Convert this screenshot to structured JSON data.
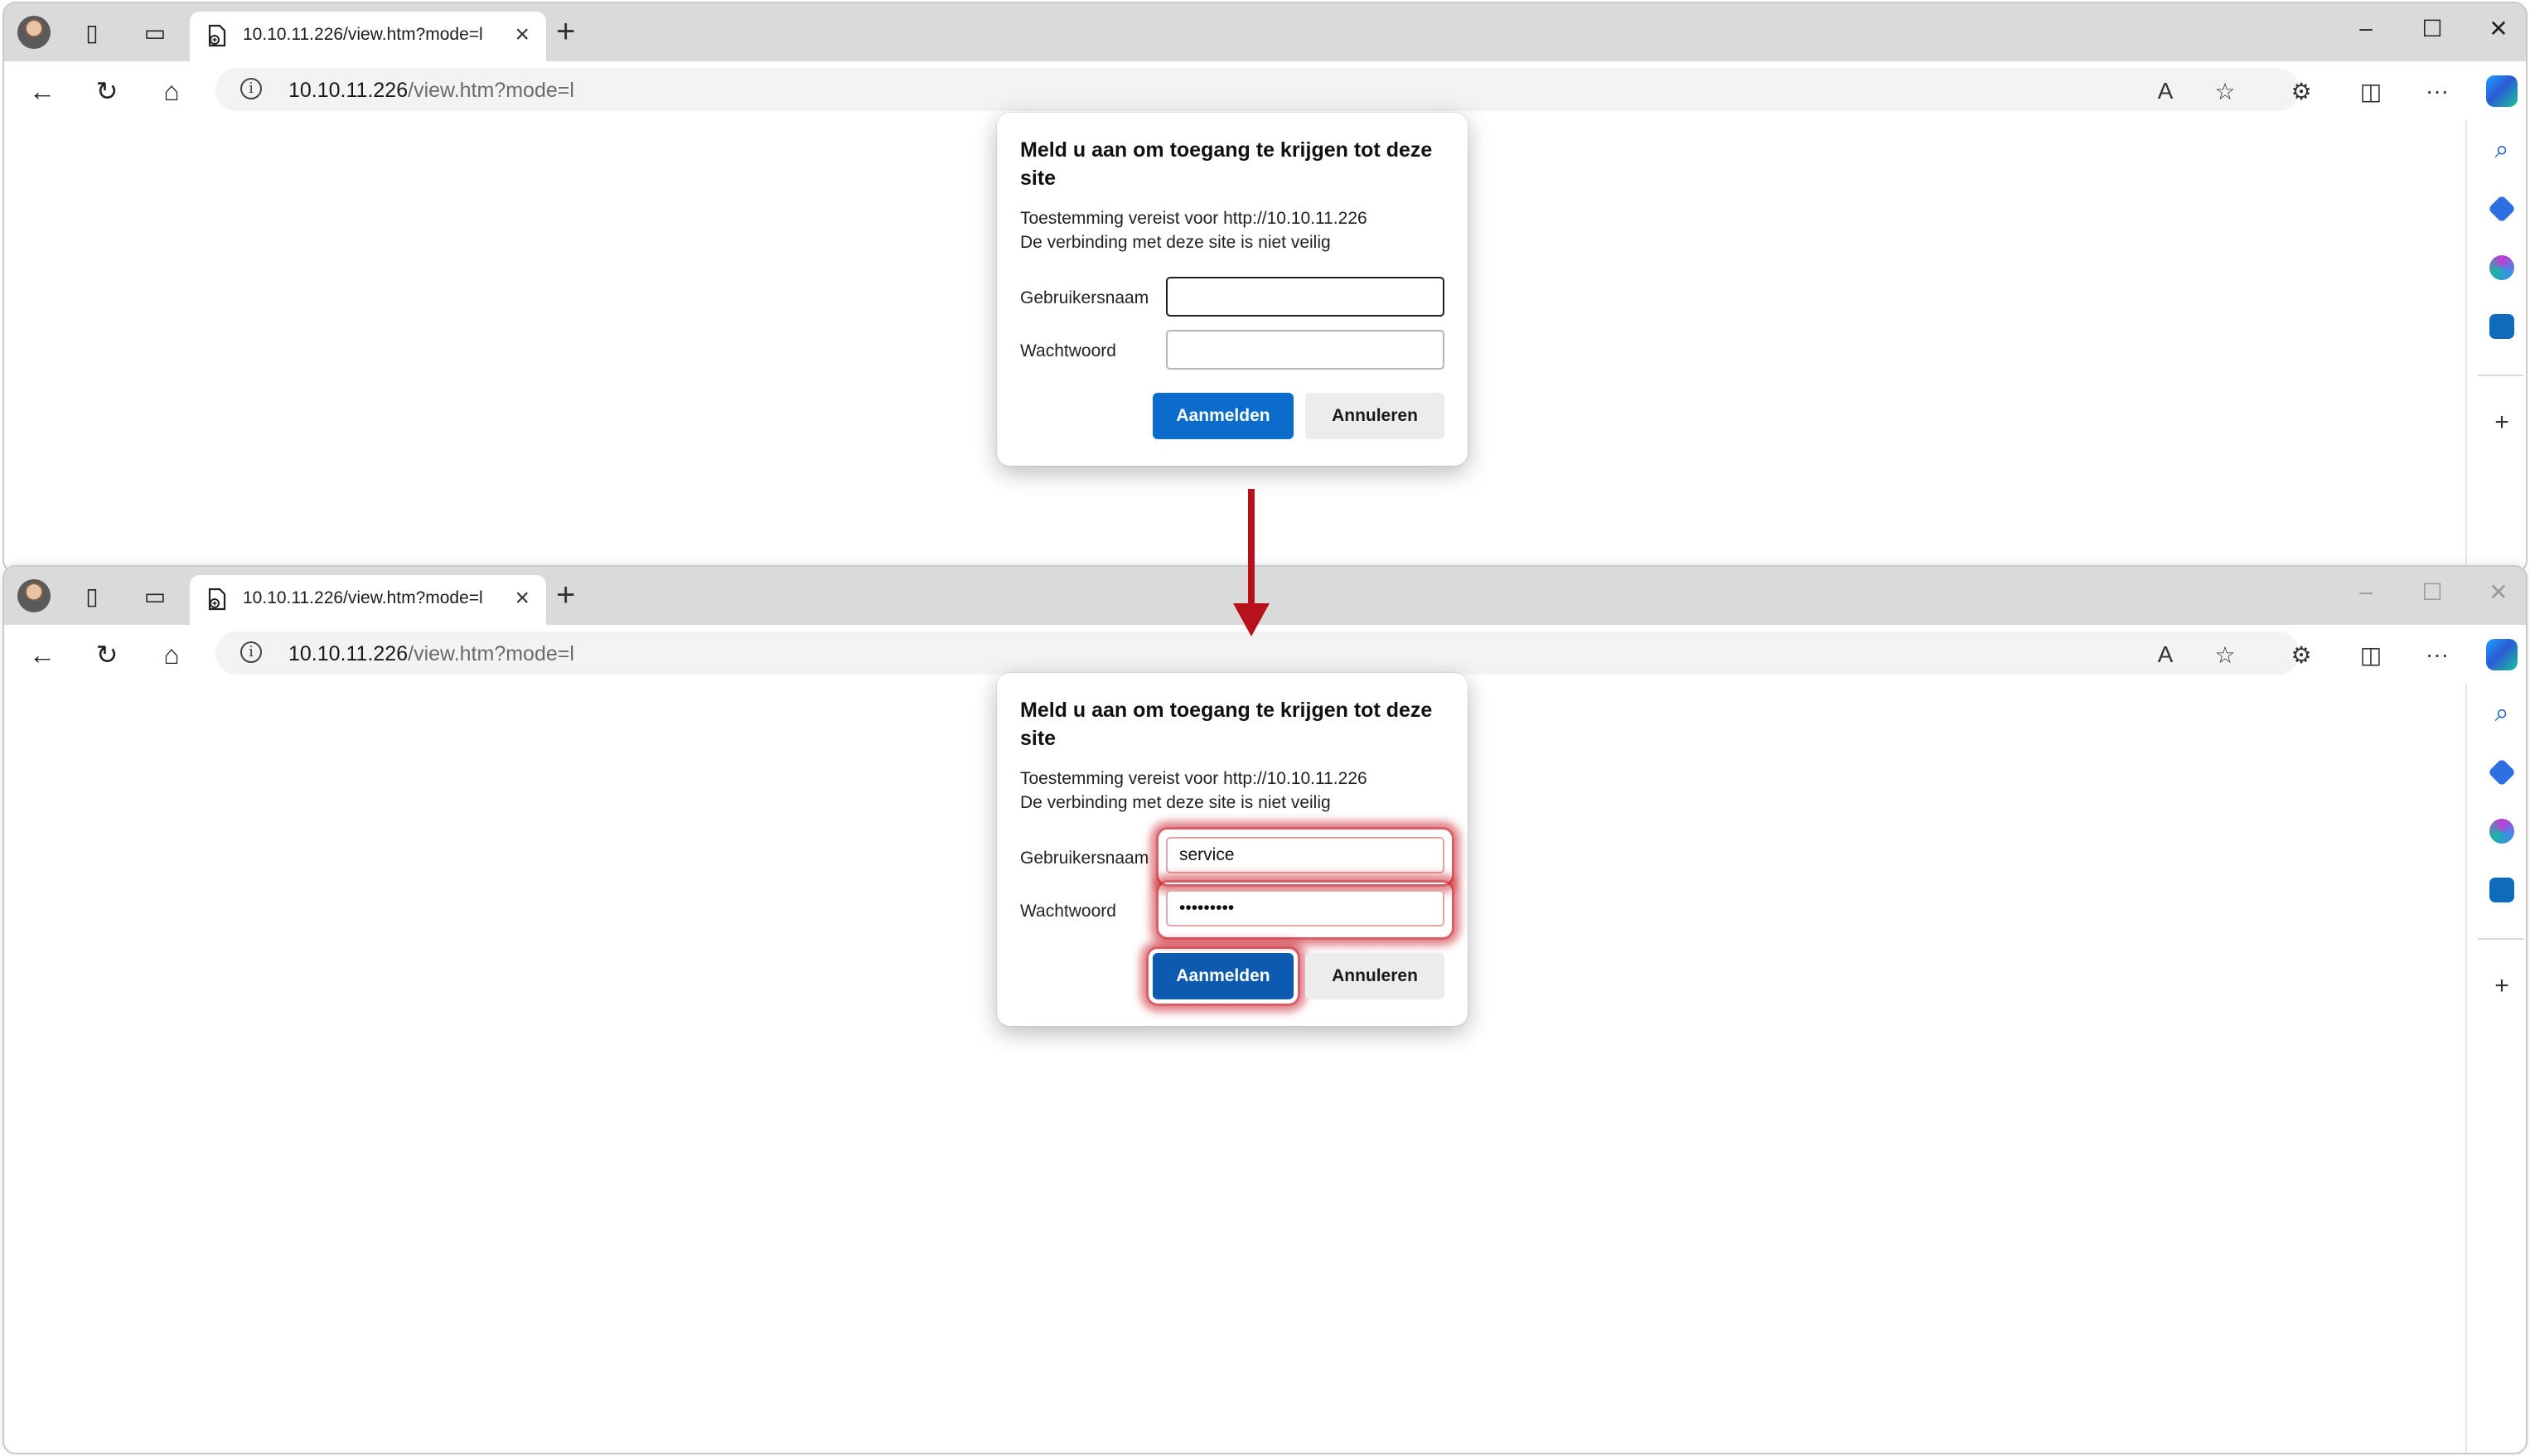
{
  "browser_top": {
    "tab": {
      "title": "10.10.11.226/view.htm?mode=l"
    },
    "address": {
      "host": "10.10.11.226",
      "path": "/view.htm?mode=l"
    },
    "dialog": {
      "title": "Meld u aan om toegang te krijgen tot deze site",
      "permission_line": "Toestemming vereist voor http://10.10.11.226",
      "security_line": "De verbinding met deze site is niet veilig",
      "username_label": "Gebruikersnaam",
      "username_value": "",
      "password_label": "Wachtwoord",
      "password_value": "",
      "signin_label": "Aanmelden",
      "cancel_label": "Annuleren"
    }
  },
  "browser_bottom": {
    "tab": {
      "title": "10.10.11.226/view.htm?mode=l"
    },
    "address": {
      "host": "10.10.11.226",
      "path": "/view.htm?mode=l"
    },
    "dialog": {
      "title": "Meld u aan om toegang te krijgen tot deze site",
      "permission_line": "Toestemming vereist voor http://10.10.11.226",
      "security_line": "De verbinding met deze site is niet veilig",
      "username_label": "Gebruikersnaam",
      "username_value": "service",
      "password_label": "Wachtwoord",
      "password_value": "•••••••••",
      "signin_label": "Aanmelden",
      "cancel_label": "Annuleren"
    }
  },
  "icons": {
    "tab_actions": "▯",
    "vertical_tabs": "▭",
    "tab_close": "×",
    "new_tab": "+",
    "minimize": "–",
    "maximize": "☐",
    "close_window": "✕",
    "back": "←",
    "refresh": "↻",
    "home": "⌂",
    "info": "i",
    "read_aloud": "A",
    "favorite": "☆",
    "extensions": "⚙",
    "split_screen": "◫",
    "more": "···",
    "search": "⌕",
    "add": "+"
  },
  "colors": {
    "accent": "#0b6ccb",
    "highlight": "#c81e28",
    "arrow": "#b5121b",
    "tab_strip": "#dadada"
  }
}
